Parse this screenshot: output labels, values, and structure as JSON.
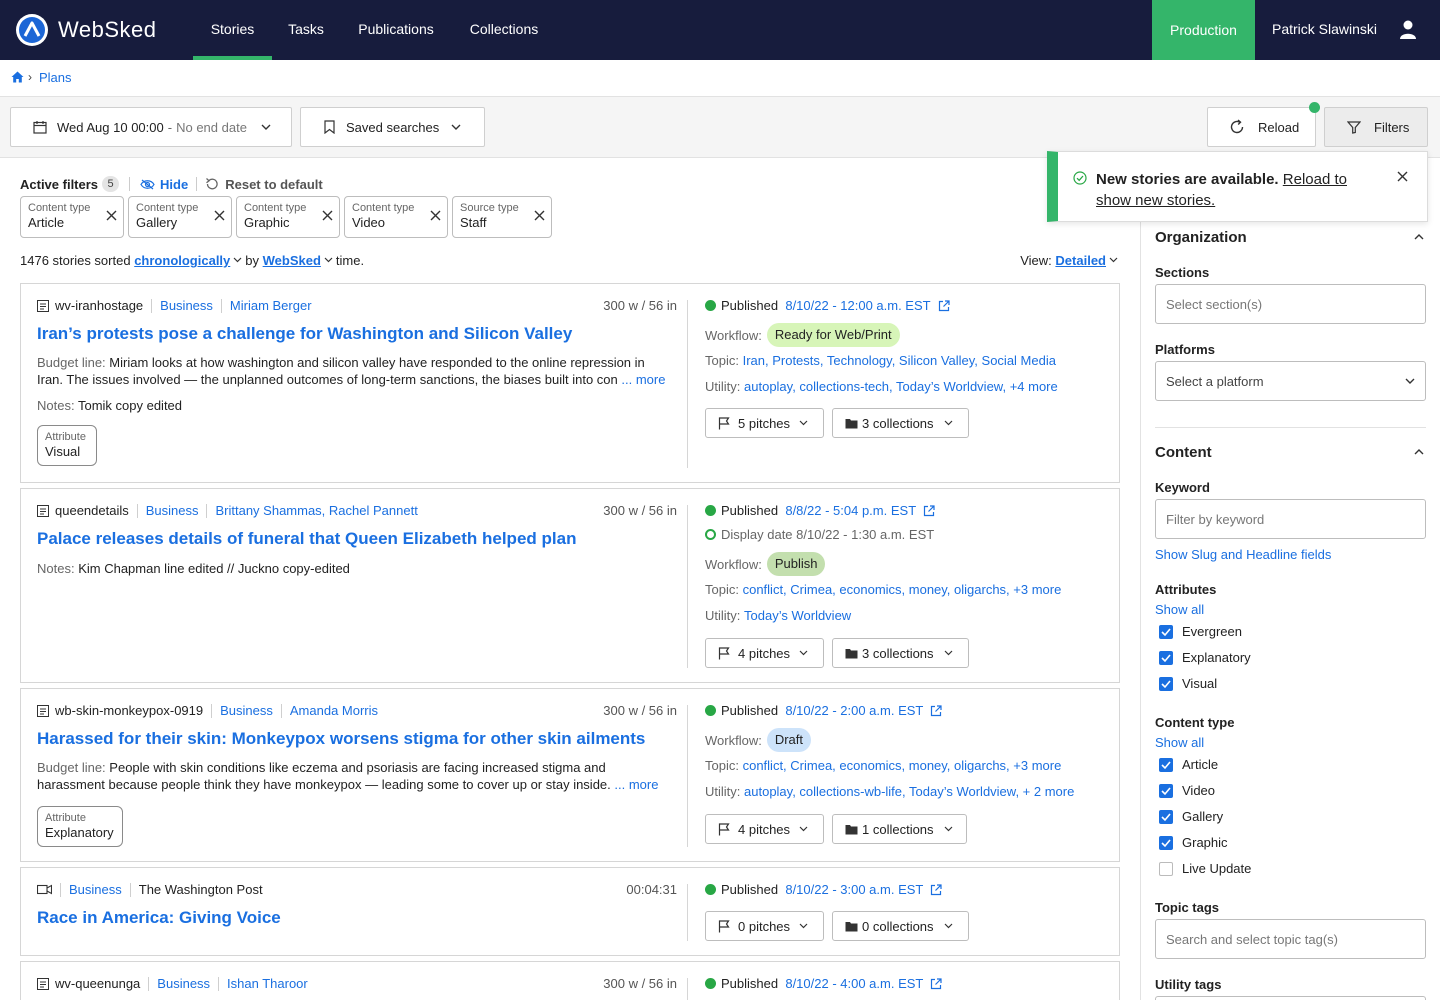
{
  "nav": {
    "brand": "WebSked",
    "tabs": [
      {
        "label": "Stories",
        "active": true
      },
      {
        "label": "Tasks"
      },
      {
        "label": "Publications"
      },
      {
        "label": "Collections"
      }
    ],
    "environment": "Production",
    "user": "Patrick Slawinski"
  },
  "breadcrumb": {
    "current": "Plans"
  },
  "toolbar": {
    "date_value": "Wed Aug 10 00:00",
    "date_end": "No end date",
    "saved_searches": "Saved searches",
    "reload": "Reload",
    "filters": "Filters"
  },
  "active_filters": {
    "label": "Active filters",
    "count": "5",
    "hide": "Hide",
    "reset": "Reset to default",
    "chips": [
      {
        "key": "Content type",
        "value": "Article"
      },
      {
        "key": "Content type",
        "value": "Gallery"
      },
      {
        "key": "Content type",
        "value": "Graphic"
      },
      {
        "key": "Content type",
        "value": "Video"
      },
      {
        "key": "Source type",
        "value": "Staff"
      }
    ]
  },
  "summary": {
    "count_text": "1476 stories sorted",
    "sort": "chronologically",
    "by": "by",
    "sort_source": "WebSked",
    "suffix": "time.",
    "view_label": "View:",
    "view_value": "Detailed"
  },
  "toast": {
    "bold": "New stories are available.",
    "link": "Reload to show new stories."
  },
  "stories": [
    {
      "slug": "wv-iranhostage",
      "section": "Business",
      "author": "Miriam Berger",
      "length": "300 w / 56 in",
      "headline": "Iran’s protests pose a challenge for Washington and Silicon Valley",
      "budget_label": "Budget line:",
      "budget": "Miriam looks at how washington and silicon valley have responded to the online repression in Iran. The issues involved — the unplanned outcomes of long-term sanctions, the biases built into con",
      "more": "... more",
      "notes_label": "Notes:",
      "notes": "Tomik copy edited",
      "attr_key": "Attribute",
      "attr_value": "Visual",
      "published_label": "Published",
      "published": "8/10/22 - 12:00 a.m. EST",
      "workflow_label": "Workflow:",
      "workflow": "Ready for Web/Print",
      "topic_label": "Topic:",
      "topics": "Iran, Protests, Technology, Silicon Valley, Social Media",
      "utility_label": "Utility:",
      "utility": "autoplay, collections-tech, Today’s Worldview, +4 more",
      "pitches": "5 pitches",
      "collections": "3 collections"
    },
    {
      "slug": "queendetails",
      "section": "Business",
      "author": "Brittany Shammas, Rachel Pannett",
      "length": "300 w / 56 in",
      "headline": "Palace releases details of funeral that Queen Elizabeth helped plan",
      "notes_label": "Notes:",
      "notes": "Kim Chapman line edited // Juckno copy-edited",
      "published_label": "Published",
      "published": "8/8/22 - 5:04 p.m. EST",
      "display_label": "Display date",
      "display": "8/10/22 - 1:30 a.m. EST",
      "workflow_label": "Workflow:",
      "workflow": "Publish",
      "topic_label": "Topic:",
      "topics": "conflict, Crimea, economics, money, oligarchs, +3 more",
      "utility_label": "Utility:",
      "utility": "Today’s Worldview",
      "pitches": "4 pitches",
      "collections": "3 collections"
    },
    {
      "slug": "wb-skin-monkeypox-0919",
      "section": "Business",
      "author": "Amanda Morris",
      "length": "300 w / 56 in",
      "headline": "Harassed for their skin: Monkeypox worsens stigma for other skin ailments",
      "budget_label": "Budget line:",
      "budget": "People with skin conditions like eczema and psoriasis are facing increased stigma and harassment because people think they have monkeypox — leading some to cover up or stay inside.",
      "more": "... more",
      "attr_key": "Attribute",
      "attr_value": "Explanatory",
      "published_label": "Published",
      "published": "8/10/22 - 2:00 a.m. EST",
      "workflow_label": "Workflow:",
      "workflow": "Draft",
      "topic_label": "Topic:",
      "topics": "conflict, Crimea, economics, money, oligarchs, +3 more",
      "utility_label": "Utility:",
      "utility": "autoplay, collections-wb-life, Today’s Worldview, + 2 more",
      "pitches": "4 pitches",
      "collections": "1 collections"
    },
    {
      "section": "Business",
      "source": "The Washington Post",
      "length": "00:04:31",
      "headline": "Race in America: Giving Voice",
      "published_label": "Published",
      "published": "8/10/22 - 3:00 a.m. EST",
      "pitches": "0 pitches",
      "collections": "0 collections"
    },
    {
      "slug": "wv-queenunga",
      "section": "Business",
      "author": "Ishan Tharoor",
      "length": "300 w / 56 in",
      "published_label": "Published",
      "published": "8/10/22 - 4:00 a.m. EST"
    }
  ],
  "panel": {
    "organization": "Organization",
    "sections_label": "Sections",
    "sections_placeholder": "Select section(s)",
    "platforms_label": "Platforms",
    "platforms_placeholder": "Select a platform",
    "content": "Content",
    "keyword_label": "Keyword",
    "keyword_placeholder": "Filter by keyword",
    "show_slug": "Show Slug and Headline fields",
    "attributes_label": "Attributes",
    "show_all": "Show all",
    "attributes": [
      {
        "label": "Evergreen",
        "checked": true
      },
      {
        "label": "Explanatory",
        "checked": true
      },
      {
        "label": "Visual",
        "checked": true
      }
    ],
    "content_type_label": "Content type",
    "content_types": [
      {
        "label": "Article",
        "checked": true
      },
      {
        "label": "Video",
        "checked": true
      },
      {
        "label": "Gallery",
        "checked": true
      },
      {
        "label": "Graphic",
        "checked": true
      },
      {
        "label": "Live Update",
        "checked": false
      }
    ],
    "topic_tags_label": "Topic tags",
    "topic_tags_placeholder": "Search and select topic tag(s)",
    "utility_tags_label": "Utility tags"
  },
  "colors": {
    "nav_bg": "#171c3d",
    "accent_green": "#34b56a",
    "link_blue": "#1a6fe0",
    "pill_ready": "#d7f5b8",
    "pill_publish": "#c3dfae",
    "pill_draft": "#cde3fa"
  }
}
